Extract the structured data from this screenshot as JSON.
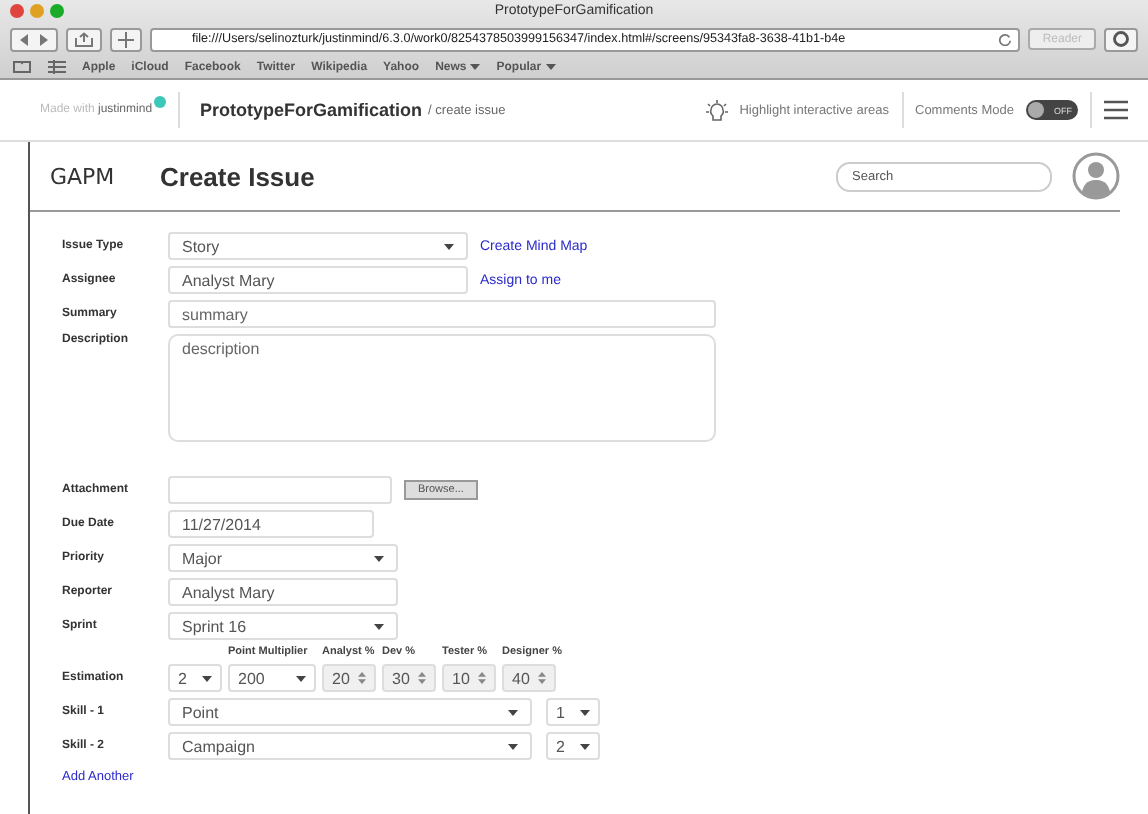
{
  "browser": {
    "title": "PrototypeForGamification",
    "url": "file:///Users/selinozturk/justinmind/6.3.0/work0/8254378503999156347/index.html#/screens/95343fa8-3638-41b1-b4e",
    "reader": "Reader",
    "bookmarks": [
      {
        "label": "Apple",
        "has_menu": false
      },
      {
        "label": "iCloud",
        "has_menu": false
      },
      {
        "label": "Facebook",
        "has_menu": false
      },
      {
        "label": "Twitter",
        "has_menu": false
      },
      {
        "label": "Wikipedia",
        "has_menu": false
      },
      {
        "label": "Yahoo",
        "has_menu": false
      },
      {
        "label": "News",
        "has_menu": true
      },
      {
        "label": "Popular",
        "has_menu": true
      }
    ]
  },
  "app_bar": {
    "made_with": "Made with",
    "brand": "justinmind",
    "project": "PrototypeForGamification",
    "path": "/ create issue",
    "highlight": "Highlight interactive areas",
    "comments": "Comments Mode",
    "toggle": {
      "label": "OFF",
      "on": false
    }
  },
  "page": {
    "logo": "GAPM",
    "title": "Create Issue",
    "search": {
      "placeholder": "Search"
    }
  },
  "form": [
    {
      "kind": "select",
      "label": "Issue Type",
      "value": "Story",
      "link": "Create Mind Map"
    },
    {
      "kind": "text",
      "label": "Assignee",
      "value": "Analyst Mary",
      "link": "Assign to me"
    },
    {
      "kind": "text",
      "label": "Summary",
      "placeholder": "summary"
    },
    {
      "kind": "textarea",
      "label": "Description",
      "placeholder": "description"
    },
    {
      "kind": "file",
      "label": "Attachment",
      "button": "Browse..."
    },
    {
      "kind": "text",
      "label": "Due Date",
      "value": "11/27/2014"
    },
    {
      "kind": "select",
      "label": "Priority",
      "value": "Major"
    },
    {
      "kind": "text",
      "label": "Reporter",
      "value": "Analyst Mary"
    },
    {
      "kind": "select",
      "label": "Sprint",
      "value": "Sprint 16"
    },
    {
      "kind": "estimation",
      "label": "Estimation",
      "parts": [
        {
          "kind": "select",
          "value": "2"
        },
        {
          "kind": "select",
          "heading": "Point Multiplier",
          "value": "200"
        },
        {
          "kind": "spinner",
          "heading": "Analyst %",
          "value": "20"
        },
        {
          "kind": "spinner",
          "heading": "Dev %",
          "value": "30"
        },
        {
          "kind": "spinner",
          "heading": "Tester %",
          "value": "10"
        },
        {
          "kind": "spinner",
          "heading": "Designer %",
          "value": "40"
        }
      ]
    },
    {
      "kind": "skill",
      "label": "Skill - 1",
      "value": "Point",
      "level_value": "1"
    },
    {
      "kind": "skill",
      "label": "Skill - 2",
      "value": "Campaign",
      "level_value": "2"
    }
  ],
  "add_link": "Add Another"
}
